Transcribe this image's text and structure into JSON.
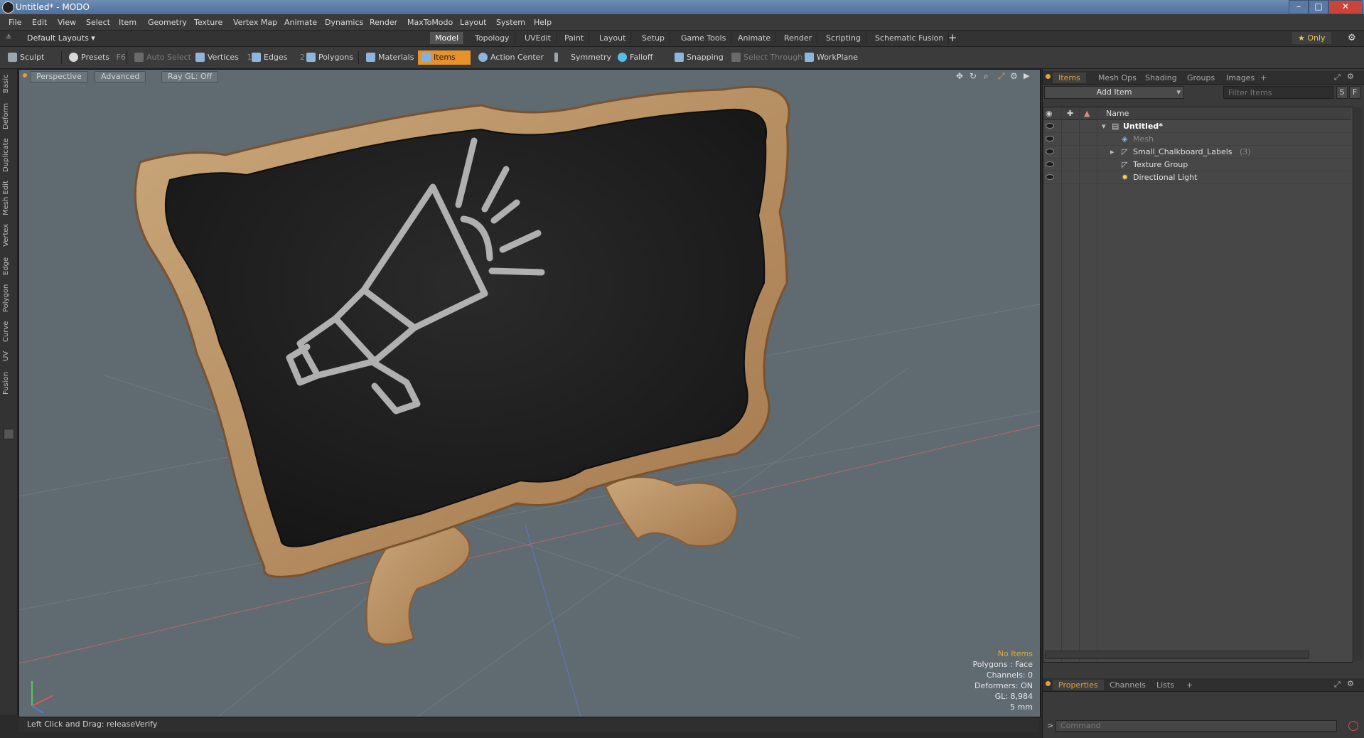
{
  "window": {
    "title": "Untitled* - MODO",
    "min": "–",
    "max": "□",
    "close": "✕"
  },
  "menu": [
    "File",
    "Edit",
    "View",
    "Select",
    "Item",
    "Geometry",
    "Texture",
    "Vertex Map",
    "Animate",
    "Dynamics",
    "Render",
    "MaxToModo",
    "Layout",
    "System",
    "Help"
  ],
  "layouts": {
    "preset": "Default Layouts ▾",
    "tabs": [
      "Model",
      "Topology",
      "UVEdit",
      "Paint",
      "Layout",
      "Setup",
      "Game Tools",
      "Animate",
      "Render",
      "Scripting",
      "Schematic Fusion"
    ],
    "plus": "+",
    "only": "★  Only",
    "gear": "⚙"
  },
  "toolbar": {
    "sculpt": "Sculpt",
    "presets": "Presets",
    "presets_key": "F6",
    "auto_select": "Auto Select",
    "vertices": "Vertices",
    "vertices_count": "1",
    "edges": "Edges",
    "edges_count": "2",
    "polygons": "Polygons",
    "materials": "Materials",
    "items": "Items",
    "action_center": "Action Center",
    "symmetry": "Symmetry",
    "falloff": "Falloff",
    "snapping": "Snapping",
    "select_through": "Select Through",
    "workplane": "WorkPlane"
  },
  "left_tabs": [
    "Basic",
    "Deform",
    "Duplicate",
    "Mesh Edit",
    "Vertex",
    "Edge",
    "Polygon",
    "Curve",
    "UV",
    "Fusion"
  ],
  "viewport": {
    "view": "Perspective",
    "shading": "Advanced",
    "raygl": "Ray GL: Off",
    "info": {
      "items": "No Items",
      "polygons": "Polygons : Face",
      "channels": "Channels: 0",
      "deformers": "Deformers: ON",
      "gl": "GL: 8,984",
      "scale": "5 mm"
    }
  },
  "status": {
    "text": "Left Click and Drag:   releaseVerify"
  },
  "right": {
    "tabs": [
      "Items",
      "Mesh Ops",
      "Shading",
      "Groups",
      "Images"
    ],
    "plus": "+",
    "add_item": "Add Item",
    "filter_placeholder": "Filter Items",
    "s_btn": "S",
    "f_btn": "F",
    "col_name": "Name",
    "tree": [
      {
        "name": "Untitled*",
        "bold": true,
        "indent": 0
      },
      {
        "name": "Mesh",
        "dim": true,
        "indent": 1
      },
      {
        "name": "Small_Chalkboard_Labels",
        "count": "(3)",
        "indent": 1
      },
      {
        "name": "Texture Group",
        "indent": 1
      },
      {
        "name": "Directional Light",
        "indent": 1
      }
    ],
    "bottom_tabs": [
      "Properties",
      "Channels",
      "Lists"
    ],
    "command_placeholder": "Command",
    "prompt": ">"
  }
}
